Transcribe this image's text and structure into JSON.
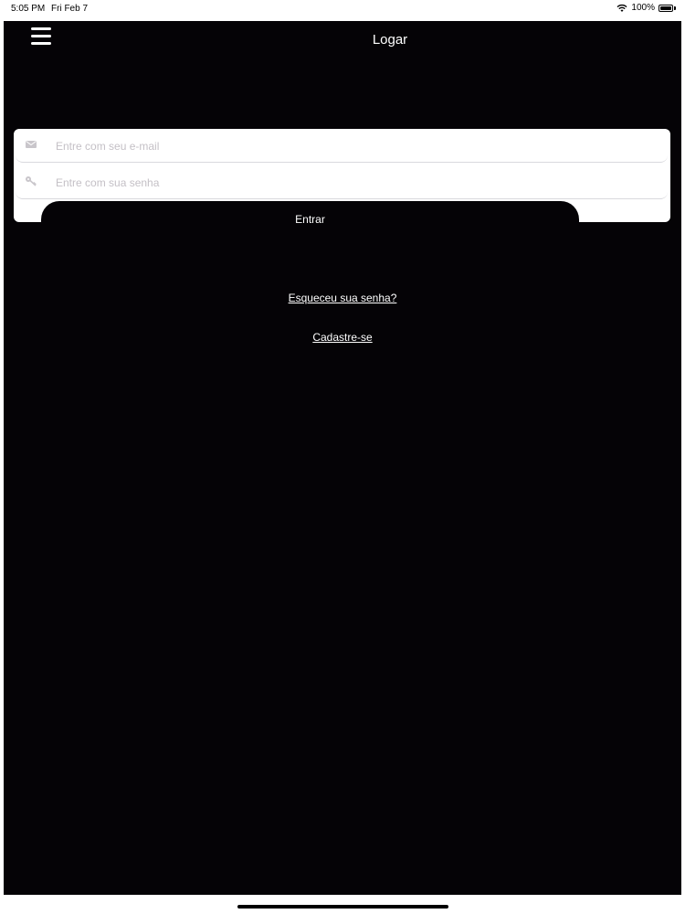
{
  "status_bar": {
    "time": "5:05 PM",
    "date": "Fri Feb 7",
    "battery": "100%"
  },
  "nav": {
    "title": "Logar",
    "menu_icon": "hamburger-menu-icon"
  },
  "form": {
    "email_placeholder": "Entre com seu e-mail",
    "email_icon": "envelope-icon",
    "password_placeholder": "Entre com sua senha",
    "password_icon": "key-icon",
    "submit_label": "Entrar"
  },
  "links": {
    "forgot": "Esqueceu sua senha?",
    "register": "Cadastre-se"
  },
  "colors": {
    "background": "#050306",
    "card": "#ffffff",
    "text_light": "#ffffff",
    "placeholder": "#c4c0c6"
  }
}
